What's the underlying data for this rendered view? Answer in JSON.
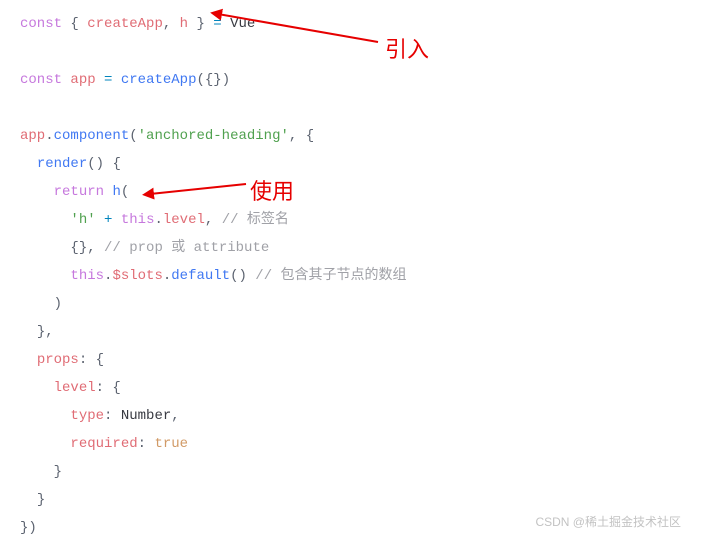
{
  "code": {
    "l1_const": "const",
    "l1_brace_open": " { ",
    "l1_createApp": "createApp",
    "l1_comma": ", ",
    "l1_h": "h",
    "l1_brace_close": " } ",
    "l1_eq": "= ",
    "l1_vue": "Vue",
    "l3_const": "const",
    "l3_sp": " ",
    "l3_app": "app",
    "l3_eq": " = ",
    "l3_create": "createApp",
    "l3_paren": "({})",
    "l5_app": "app",
    "l5_dot": ".",
    "l5_component": "component",
    "l5_open": "(",
    "l5_str": "'anchored-heading'",
    "l5_comma": ", {",
    "l6_pad": "  ",
    "l6_render": "render",
    "l6_paren": "() {",
    "l7_pad": "    ",
    "l7_return": "return",
    "l7_sp": " ",
    "l7_h": "h",
    "l7_open": "(",
    "l8_pad": "      ",
    "l8_str": "'h'",
    "l8_plus": " + ",
    "l8_this": "this",
    "l8_dot": ".",
    "l8_level": "level",
    "l8_comma": ", ",
    "l8_comment": "// 标签名",
    "l9_pad": "      ",
    "l9_braces": "{}, ",
    "l9_comment": "// prop 或 attribute",
    "l10_pad": "      ",
    "l10_this": "this",
    "l10_dot1": ".",
    "l10_slots": "$slots",
    "l10_dot2": ".",
    "l10_default": "default",
    "l10_paren": "() ",
    "l10_comment": "// 包含其子节点的数组",
    "l11_pad": "    ",
    "l11_close": ")",
    "l12_pad": "  ",
    "l12_close": "},",
    "l13_pad": "  ",
    "l13_props": "props",
    "l13_colon": ": {",
    "l14_pad": "    ",
    "l14_level": "level",
    "l14_colon": ": {",
    "l15_pad": "      ",
    "l15_type": "type",
    "l15_colon": ": ",
    "l15_number": "Number",
    "l15_comma": ",",
    "l16_pad": "      ",
    "l16_required": "required",
    "l16_colon": ": ",
    "l16_true": "true",
    "l17_pad": "    ",
    "l17_close": "}",
    "l18_pad": "  ",
    "l18_close": "}",
    "l19_close": "})"
  },
  "annotations": {
    "import": "引入",
    "use": "使用"
  },
  "watermark": "CSDN @稀土掘金技术社区"
}
